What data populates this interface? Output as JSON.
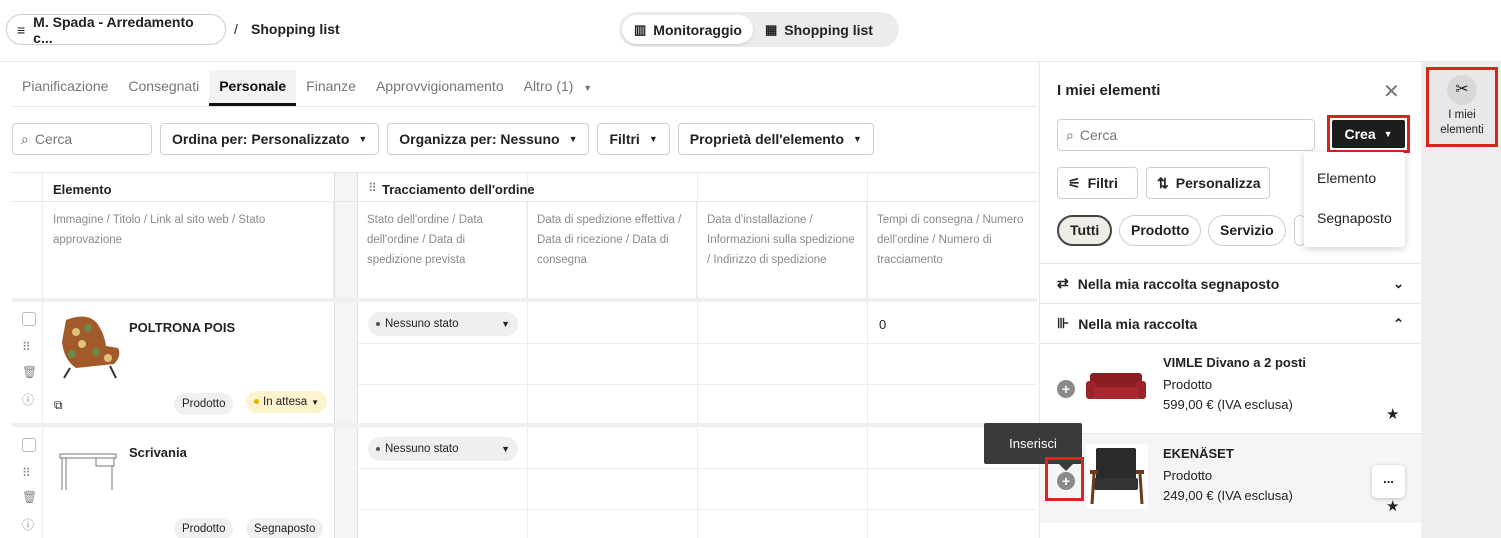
{
  "header": {
    "project": "M. Spada - Arredamento c...",
    "separator": "/",
    "current": "Shopping list",
    "views": [
      {
        "label": "Monitoraggio",
        "icon": "columns-icon",
        "active": true
      },
      {
        "label": "Shopping list",
        "icon": "grid-icon",
        "active": false
      }
    ]
  },
  "tabs": [
    "Pianificazione",
    "Consegnati",
    "Personale",
    "Finanze",
    "Approvvigionamento",
    "Altro (1)"
  ],
  "active_tab": "Personale",
  "toolbar": {
    "search_placeholder": "Cerca",
    "sort": "Ordina per: Personalizzato",
    "organize": "Organizza per: Nessuno",
    "filters": "Filtri",
    "properties": "Proprietà dell'elemento"
  },
  "table": {
    "col_element": "Elemento",
    "col_tracking": "Tracciamento dell'ordine",
    "subheaders": [
      "Immagine / Titolo / Link al sito web / Stato approvazione",
      "Stato dell'ordine / Data dell'ordine / Data di spedizione prevista",
      "Data di spedizione effettiva / Data di ricezione / Data di consegna",
      "Data d'installazione / Informazioni sulla spedizione / Indirizzo di spedizione",
      "Tempi di consegna / Numero dell'ordine / Numero di tracciamento"
    ],
    "rows": [
      {
        "title": "POLTRONA POIS",
        "type": "Prodotto",
        "approval": "In attesa",
        "status": "Nessuno stato",
        "lead_time": "0"
      },
      {
        "title": "Scrivania",
        "type": "Prodotto",
        "approval": "Segnaposto",
        "status": "Nessuno stato",
        "lead_time": ""
      }
    ]
  },
  "panel": {
    "title": "I miei elementi",
    "search_placeholder": "Cerca",
    "create": "Crea",
    "create_menu": [
      "Elemento",
      "Segnaposto"
    ],
    "filters": "Filtri",
    "customize": "Personalizza",
    "pills": [
      "Tutti",
      "Prodotto",
      "Servizio"
    ],
    "sections": [
      {
        "label": "Nella mia raccolta segnaposto",
        "expanded": false
      },
      {
        "label": "Nella mia raccolta",
        "expanded": true
      }
    ],
    "items": [
      {
        "title": "VIMLE Divano a 2 posti",
        "type": "Prodotto",
        "price": "599,00 € (IVA esclusa)"
      },
      {
        "title": "EKENÄSET",
        "type": "Prodotto",
        "price": "249,00 € (IVA esclusa)"
      }
    ],
    "more": "...",
    "tooltip": "Inserisci"
  },
  "rail": {
    "label": "I miei elementi"
  }
}
